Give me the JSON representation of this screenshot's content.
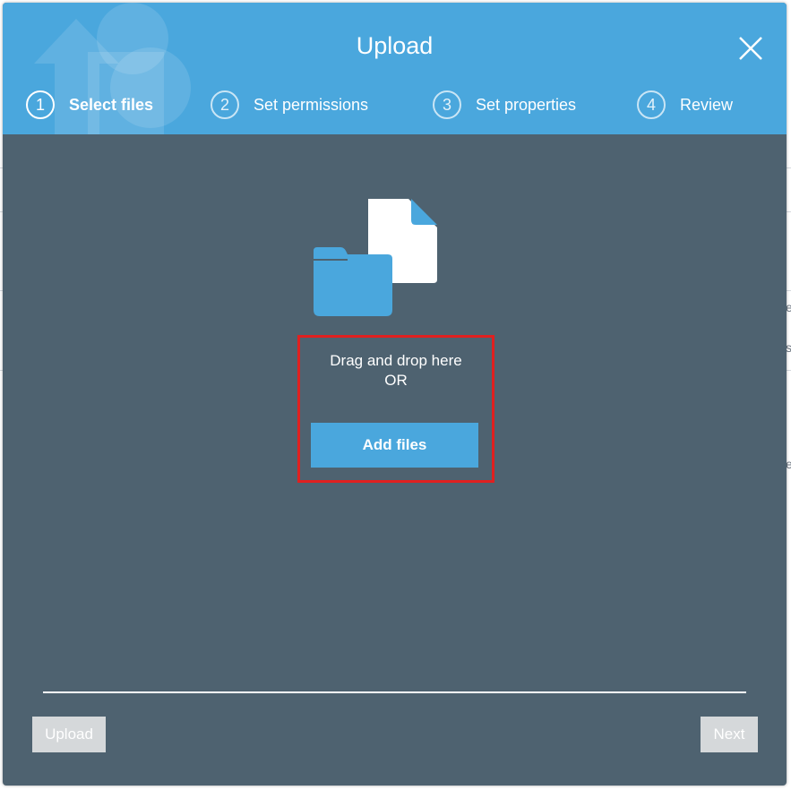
{
  "modal": {
    "title": "Upload"
  },
  "steps": [
    {
      "number": "1",
      "label": "Select files",
      "active": true
    },
    {
      "number": "2",
      "label": "Set permissions",
      "active": false
    },
    {
      "number": "3",
      "label": "Set properties",
      "active": false
    },
    {
      "number": "4",
      "label": "Review",
      "active": false
    }
  ],
  "drop_zone": {
    "line1": "Drag and drop here",
    "line2": "OR",
    "add_files_label": "Add files"
  },
  "footer": {
    "upload_label": "Upload",
    "next_label": "Next"
  },
  "background_glyphs": [
    "e",
    "s",
    "e"
  ],
  "colors": {
    "header_blue": "#4aa7dd",
    "body_slate": "#4e6270",
    "highlight_red": "#e02020",
    "disabled_button": "#d5d8da"
  }
}
